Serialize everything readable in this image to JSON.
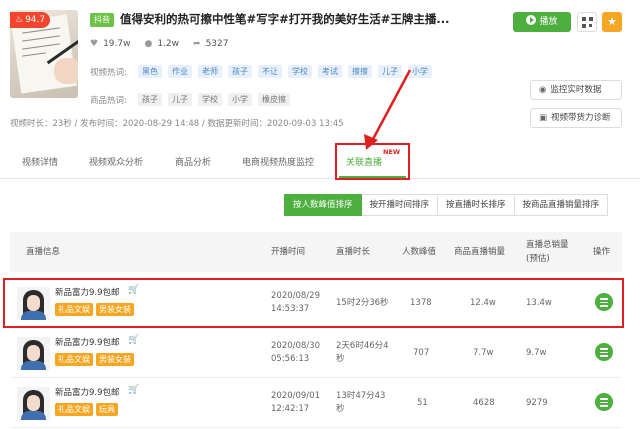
{
  "video": {
    "heat": "94.7",
    "tag": "抖音",
    "title": "值得安利的热可擦中性笔#写字#打开我的美好生活#王牌主播...",
    "likes": "19.7w",
    "comments": "1.2w",
    "shares": "5327",
    "play_label": "播放"
  },
  "hot_words": {
    "video_label": "视频热词:",
    "video_words": [
      "黑色",
      "作业",
      "老师",
      "孩子",
      "不让",
      "学校",
      "考试",
      "擦擦",
      "儿子",
      "小学"
    ],
    "product_label": "商品热词:",
    "product_words": [
      "孩子",
      "儿子",
      "学校",
      "小学",
      "橡皮擦"
    ]
  },
  "side": {
    "monitor_label": "监控实时数据",
    "diagnose_label": "视频带货力诊断"
  },
  "meta": "视频时长：23秒 / 发布时间：2020-08-29 14:48 / 数据更新时间：2020-09-03 13:45",
  "tabs": [
    {
      "label": "视频详情"
    },
    {
      "label": "视频观众分析"
    },
    {
      "label": "商品分析"
    },
    {
      "label": "电商视频热度监控"
    },
    {
      "label": "关联直播"
    }
  ],
  "new_badge": "NEW",
  "sort_buttons": [
    {
      "label": "按人数峰值排序"
    },
    {
      "label": "按开播时间排序"
    },
    {
      "label": "按直播时长排序"
    },
    {
      "label": "按商品直播销量排序"
    }
  ],
  "table": {
    "headers": {
      "info": "直播信息",
      "start": "开播时间",
      "duration": "直播时长",
      "peak": "人数峰值",
      "sales": "商品直播销量",
      "total_sales_1": "直播总销量",
      "total_sales_2": "(预估)",
      "op": "操作"
    },
    "rows": [
      {
        "title": "新品富力9.9包邮",
        "badges": [
          "礼品文娱",
          "男装女装"
        ],
        "start_1": "2020/08/29",
        "start_2": "14:53:37",
        "duration_1": "15时2分36秒",
        "duration_2": "",
        "peak": "1378",
        "sales": "12.4w",
        "total": "13.4w"
      },
      {
        "title": "新品富力9.9包邮",
        "badges": [
          "礼品文娱",
          "男装女装"
        ],
        "start_1": "2020/08/30",
        "start_2": "05:56:13",
        "duration_1": "2天6时46分4",
        "duration_2": "秒",
        "peak": "707",
        "sales": "7.7w",
        "total": "9.7w"
      },
      {
        "title": "新品富力9.9包邮",
        "badges": [
          "礼品文娱",
          "玩具"
        ],
        "start_1": "2020/09/01",
        "start_2": "12:42:17",
        "duration_1": "13时47分43",
        "duration_2": "秒",
        "peak": "51",
        "sales": "4628",
        "total": "9279"
      }
    ]
  }
}
